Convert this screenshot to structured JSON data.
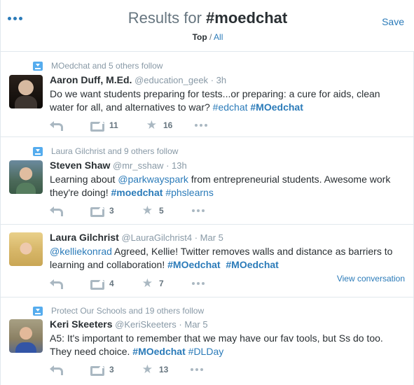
{
  "header": {
    "title_prefix": "Results for ",
    "query": "#moedchat",
    "filter_top": "Top",
    "filter_sep": " / ",
    "filter_all": "All",
    "save_label": "Save"
  },
  "tweets": [
    {
      "social_context": "MOedchat and 5 others follow",
      "name": "Aaron Duff, M.Ed.",
      "handle": "@education_geek",
      "time": "3h",
      "text_a": "Do we want students preparing for tests...or preparing: a cure for aids, clean water for all, and alternatives to war? ",
      "tag1": "#edchat",
      "tag2": "#MOedchat",
      "retweets": "11",
      "favorites": "16"
    },
    {
      "social_context": "Laura Gilchrist and 9 others follow",
      "name": "Steven Shaw",
      "handle": "@mr_sshaw",
      "time": "13h",
      "text_a": "Learning about ",
      "mention": "@parkwayspark",
      "text_b": " from entrepreneurial students. Awesome work they're doing! ",
      "tag1": "#moedchat",
      "tag2": "#phslearns",
      "retweets": "3",
      "favorites": "5"
    },
    {
      "name": "Laura Gilchrist",
      "handle": "@LauraGilchrist4",
      "time": "Mar 5",
      "mention": "@kelliekonrad",
      "text_a": " Agreed, Kellie! Twitter removes walls and distance as barriers to learning and collaboration! ",
      "tag1": "#MOedchat",
      "tag2": "#MOedchat",
      "retweets": "4",
      "favorites": "7",
      "view_conversation": "View conversation"
    },
    {
      "social_context": "Protect Our Schools and 19 others follow",
      "name": "Keri Skeeters",
      "handle": "@KeriSkeeters",
      "time": "Mar 5",
      "text_a": "A5: It's important to remember that we may have our fav tools, but Ss do too. They need choice. ",
      "tag1": "#MOedchat",
      "tag2": "#DLDay",
      "retweets": "3",
      "favorites": "13"
    }
  ],
  "icons": {
    "more": "more-dots-icon",
    "follow": "person-follow-icon",
    "reply": "reply-icon",
    "retweet": "retweet-icon",
    "favorite": "star-icon",
    "tweet_more": "ellipsis-icon"
  },
  "colors": {
    "accent": "#2b7bb9",
    "text": "#292f33",
    "muted": "#8899a6",
    "icon": "#aab8c2",
    "border": "#e1e8ed"
  }
}
